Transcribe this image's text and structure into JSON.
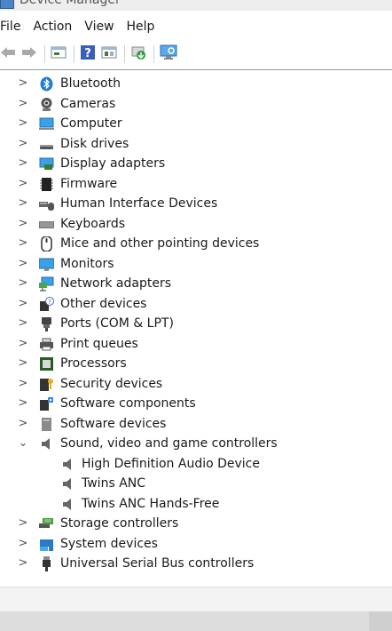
{
  "window": {
    "title": "Device Manager"
  },
  "menu": [
    "File",
    "Action",
    "View",
    "Help"
  ],
  "toolbar": {
    "buttons": [
      "back-icon",
      "forward-icon",
      "properties-icon",
      "help-icon",
      "view-icon",
      "update-driver-icon",
      "scan-hardware-icon"
    ]
  },
  "tree": [
    {
      "label": "Bluetooth",
      "icon": "bluetooth-icon",
      "expanded": false
    },
    {
      "label": "Cameras",
      "icon": "camera-icon",
      "expanded": false
    },
    {
      "label": "Computer",
      "icon": "computer-icon",
      "expanded": false
    },
    {
      "label": "Disk drives",
      "icon": "disk-drive-icon",
      "expanded": false
    },
    {
      "label": "Display adapters",
      "icon": "display-adapter-icon",
      "expanded": false
    },
    {
      "label": "Firmware",
      "icon": "firmware-icon",
      "expanded": false
    },
    {
      "label": "Human Interface Devices",
      "icon": "hid-icon",
      "expanded": false
    },
    {
      "label": "Keyboards",
      "icon": "keyboard-icon",
      "expanded": false
    },
    {
      "label": "Mice and other pointing devices",
      "icon": "mouse-icon",
      "expanded": false
    },
    {
      "label": "Monitors",
      "icon": "monitor-icon",
      "expanded": false
    },
    {
      "label": "Network adapters",
      "icon": "network-adapter-icon",
      "expanded": false
    },
    {
      "label": "Other devices",
      "icon": "other-devices-icon",
      "expanded": false
    },
    {
      "label": "Ports (COM & LPT)",
      "icon": "port-icon",
      "expanded": false
    },
    {
      "label": "Print queues",
      "icon": "printer-icon",
      "expanded": false
    },
    {
      "label": "Processors",
      "icon": "processor-icon",
      "expanded": false
    },
    {
      "label": "Security devices",
      "icon": "security-device-icon",
      "expanded": false
    },
    {
      "label": "Software components",
      "icon": "software-component-icon",
      "expanded": false
    },
    {
      "label": "Software devices",
      "icon": "software-device-icon",
      "expanded": false
    },
    {
      "label": "Sound, video and game controllers",
      "icon": "speaker-icon",
      "expanded": true,
      "children": [
        {
          "label": "High Definition Audio Device",
          "icon": "speaker-icon"
        },
        {
          "label": "Twins ANC",
          "icon": "speaker-icon"
        },
        {
          "label": "Twins ANC Hands-Free",
          "icon": "speaker-icon"
        }
      ]
    },
    {
      "label": "Storage controllers",
      "icon": "storage-controller-icon",
      "expanded": false
    },
    {
      "label": "System devices",
      "icon": "system-devices-icon",
      "expanded": false
    },
    {
      "label": "Universal Serial Bus controllers",
      "icon": "usb-icon",
      "expanded": false
    }
  ],
  "colors": {
    "accent": "#1e7fd8",
    "separator": "#9a9a9a"
  }
}
